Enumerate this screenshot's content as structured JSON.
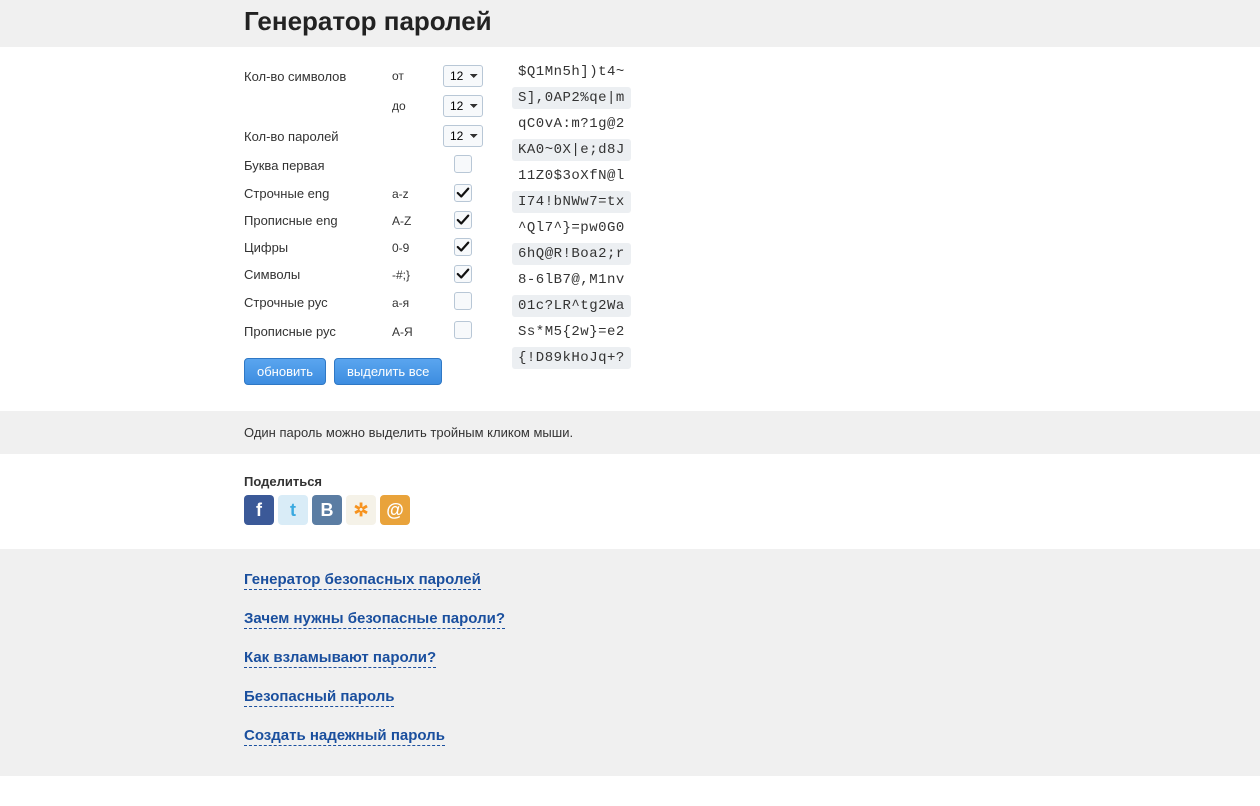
{
  "title": "Генератор паролей",
  "form": {
    "chars_label": "Кол-во символов",
    "from_label": "от",
    "to_label": "до",
    "from_value": "12",
    "to_value": "12",
    "count_label": "Кол-во паролей",
    "count_value": "12",
    "rows": [
      {
        "label": "Буква первая",
        "mid": "",
        "checked": false
      },
      {
        "label": "Строчные eng",
        "mid": "a-z",
        "checked": true
      },
      {
        "label": "Прописные eng",
        "mid": "A-Z",
        "checked": true
      },
      {
        "label": "Цифры",
        "mid": "0-9",
        "checked": true
      },
      {
        "label": "Символы",
        "mid": "-#;}",
        "checked": true
      },
      {
        "label": "Строчные рус",
        "mid": "а-я",
        "checked": false
      },
      {
        "label": "Прописные рус",
        "mid": "А-Я",
        "checked": false
      }
    ],
    "refresh_btn": "обновить",
    "select_all_btn": "выделить все"
  },
  "passwords": [
    "$Q1Mn5h])t4~",
    "S],0AP2%qe|m",
    "qC0vA:m?1g@2",
    "KA0~0X|e;d8J",
    "11Z0$3oXfN@l",
    "I74!bNWw7=tx",
    "^Ql7^}=pw0G0",
    "6hQ@R!Boa2;r",
    "8-6lB7@,M1nv",
    "01c?LR^tg2Wa",
    "Ss*M5{2w}=e2",
    "{!D89kHoJq+?"
  ],
  "hint": "Один пароль можно выделить тройным кликом мыши.",
  "share": {
    "title": "Поделиться",
    "icons": [
      {
        "name": "facebook",
        "bg": "#3b5998",
        "glyph": "f"
      },
      {
        "name": "twitter",
        "bg": "#d9ecf7",
        "fg": "#3aa9e0",
        "glyph": "t"
      },
      {
        "name": "vk",
        "bg": "#5b7da3",
        "glyph": "B"
      },
      {
        "name": "odnoklassniki",
        "bg": "#f5f2e8",
        "fg": "#f7931e",
        "glyph": "✲"
      },
      {
        "name": "mailru",
        "bg": "#e9a33b",
        "glyph": "@"
      }
    ]
  },
  "links": [
    "Генератор безопасных паролей",
    "Зачем нужны безопасные пароли?",
    "Как взламывают пароли?",
    "Безопасный пароль",
    "Создать надежный пароль"
  ]
}
